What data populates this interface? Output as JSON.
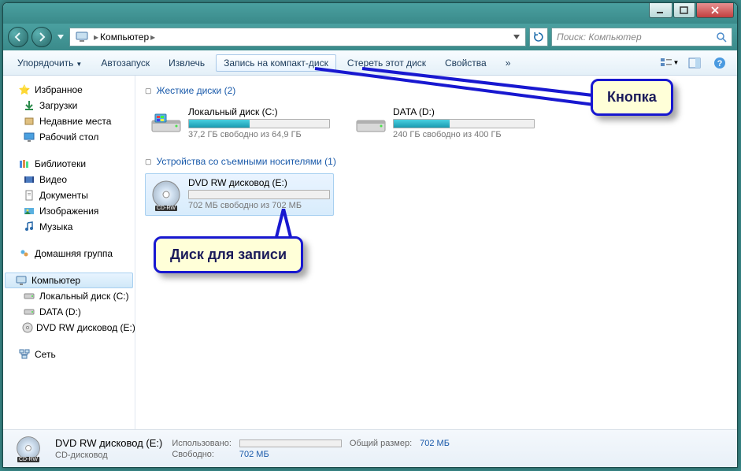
{
  "titlebar": {
    "title": ""
  },
  "nav": {
    "breadcrumb_icon": "computer",
    "breadcrumb": "Компьютер",
    "search_placeholder": "Поиск: Компьютер"
  },
  "toolbar": {
    "organize": "Упорядочить",
    "autoplay": "Автозапуск",
    "eject": "Извлечь",
    "burn": "Запись на компакт-диск",
    "erase": "Стереть этот диск",
    "props": "Свойства",
    "more": "»"
  },
  "sidebar": {
    "favorites": {
      "label": "Избранное",
      "items": [
        "Загрузки",
        "Недавние места",
        "Рабочий стол"
      ]
    },
    "libraries": {
      "label": "Библиотеки",
      "items": [
        "Видео",
        "Документы",
        "Изображения",
        "Музыка"
      ]
    },
    "homegroup": {
      "label": "Домашняя группа"
    },
    "computer": {
      "label": "Компьютер",
      "items": [
        "Локальный диск (C:)",
        "DATA (D:)",
        "DVD RW дисковод (E:)"
      ]
    },
    "network": {
      "label": "Сеть"
    }
  },
  "content": {
    "hdd_section": "Жесткие диски (2)",
    "removable_section": "Устройства со съемными носителями (1)",
    "drives": {
      "c": {
        "name": "Локальный диск (C:)",
        "free": "37,2 ГБ свободно из 64,9 ГБ",
        "fill_pct": 43
      },
      "d": {
        "name": "DATA (D:)",
        "free": "240 ГБ свободно из 400 ГБ",
        "fill_pct": 40
      },
      "e": {
        "name": "DVD RW дисковод (E:)",
        "free": "702 МБ свободно из 702 МБ",
        "fill_pct": 0,
        "badge": "CD-RW"
      }
    }
  },
  "status": {
    "title": "DVD RW дисковод (E:)",
    "subtitle": "CD-дисковод",
    "used_label": "Использовано:",
    "free_label": "Свободно:",
    "free_val": "702 МБ",
    "total_label": "Общий размер:",
    "total_val": "702 МБ",
    "badge": "CD-RW"
  },
  "callouts": {
    "button": "Кнопка",
    "disc": "Диск для записи"
  }
}
